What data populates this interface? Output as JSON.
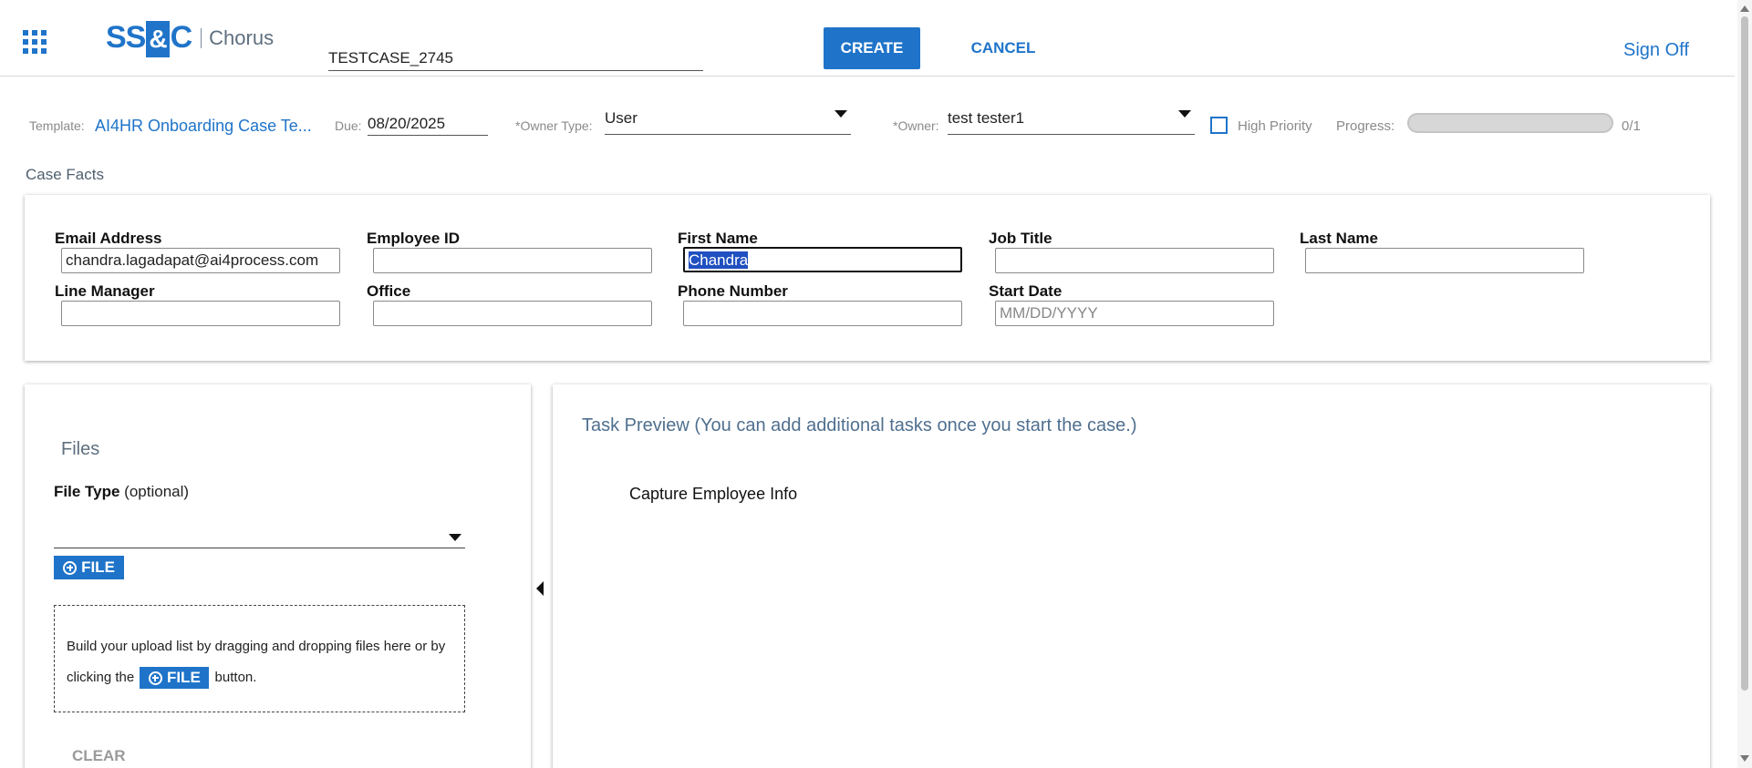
{
  "header": {
    "logo_brand": "SS&C",
    "logo_product": "Chorus",
    "case_name": "TESTCASE_2745",
    "create_label": "CREATE",
    "cancel_label": "CANCEL",
    "sign_off_label": "Sign Off"
  },
  "case_info": {
    "template_label": "Template:",
    "template_value": "AI4HR Onboarding Case Te...",
    "due_label": "Due:",
    "due_value": "08/20/2025",
    "owner_type_label": "*Owner Type:",
    "owner_type_value": "User",
    "owner_label": "*Owner:",
    "owner_value": "test tester1",
    "high_priority_label": "High Priority",
    "high_priority_checked": false,
    "progress_label": "Progress:",
    "progress_fraction": 0,
    "progress_text": "0/1"
  },
  "case_facts": {
    "title": "Case Facts",
    "fields": {
      "email": {
        "label": "Email Address",
        "value": "chandra.lagadapat@ai4process.com"
      },
      "employee_id": {
        "label": "Employee ID",
        "value": ""
      },
      "first_name": {
        "label": "First Name",
        "value": "Chandra"
      },
      "job_title": {
        "label": "Job Title",
        "value": ""
      },
      "last_name": {
        "label": "Last Name",
        "value": ""
      },
      "line_manager": {
        "label": "Line Manager",
        "value": ""
      },
      "office": {
        "label": "Office",
        "value": ""
      },
      "phone": {
        "label": "Phone Number",
        "value": ""
      },
      "start_date": {
        "label": "Start Date",
        "value": "",
        "placeholder": "MM/DD/YYYY"
      }
    }
  },
  "files": {
    "title": "Files",
    "file_type_label": "File Type",
    "file_type_optional": "(optional)",
    "file_button_label": "FILE",
    "dropzone_text_1": "Build your upload list by dragging and dropping files here or by clicking the",
    "dropzone_text_2": "button.",
    "clear_label": "CLEAR"
  },
  "tasks": {
    "title": "Task Preview (You can add additional tasks once you start the case.)",
    "items": [
      "Capture Employee Info"
    ]
  },
  "colors": {
    "accent": "#1f74c9",
    "selection": "#1f4fc0"
  }
}
